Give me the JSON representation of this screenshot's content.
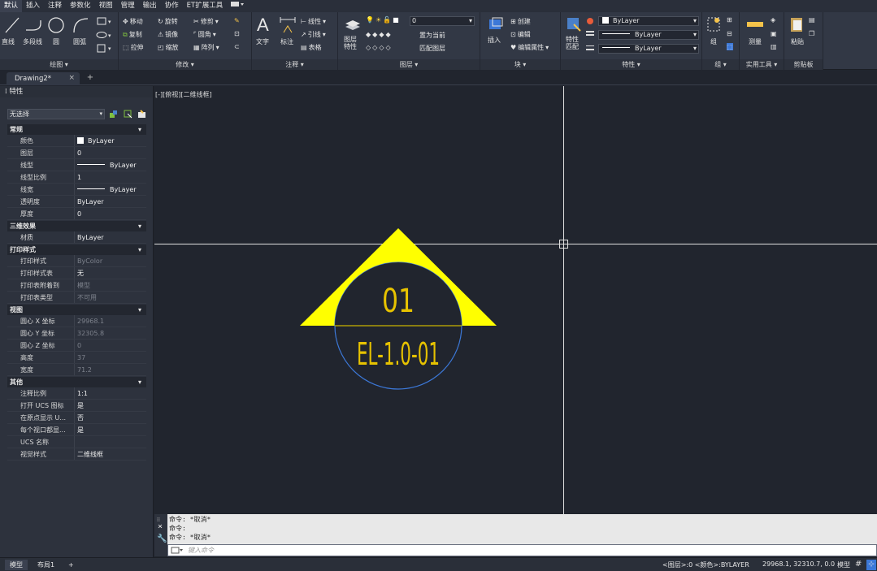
{
  "menu_tabs": [
    "默认",
    "插入",
    "注释",
    "参数化",
    "视图",
    "管理",
    "输出",
    "协作",
    "ET扩展工具"
  ],
  "ribbon": {
    "draw": {
      "line": "直线",
      "polyline": "多段线",
      "circle": "圆",
      "arc": "圆弧",
      "title": "绘图 ▾"
    },
    "modify": {
      "move": "移动",
      "rotate": "旋转",
      "trim": "修剪",
      "copy": "复制",
      "mirror": "镜像",
      "fillet": "圆角",
      "stretch": "拉伸",
      "scale": "缩放",
      "array": "阵列",
      "title": "修改 ▾"
    },
    "annotation": {
      "text": "文字",
      "dimension": "标注",
      "linear": "线性",
      "leader": "引线",
      "table": "表格",
      "title": "注释 ▾"
    },
    "layers": {
      "layer_props": "图层\n特性",
      "current_layer": "0",
      "set_current": "置为当前",
      "match_layer": "匹配图层",
      "title": "图层 ▾"
    },
    "block": {
      "insert": "插入",
      "create": "创建",
      "edit": "编辑",
      "edit_attr": "编辑属性",
      "title": "块 ▾"
    },
    "properties": {
      "match": "特性\n匹配",
      "color": "ByLayer",
      "linetype": "ByLayer",
      "lineweight": "ByLayer",
      "title": "特性 ▾"
    },
    "groups": {
      "group": "组",
      "title": "组 ▾"
    },
    "utilities": {
      "measure": "测量",
      "title": "实用工具 ▾"
    },
    "clipboard": {
      "paste": "粘贴",
      "title": "剪贴板"
    }
  },
  "doc_tab": {
    "name": "Drawing2*",
    "close": "×",
    "add": "+"
  },
  "properties_panel": {
    "title": "特性",
    "selection": "无选择",
    "sections": {
      "general": "常规",
      "3d": "三维效果",
      "plot": "打印样式",
      "view": "视图",
      "misc": "其他"
    },
    "general": [
      {
        "k": "颜色",
        "v": "ByLayer"
      },
      {
        "k": "图层",
        "v": "0"
      },
      {
        "k": "线型",
        "v": "ByLayer"
      },
      {
        "k": "线型比例",
        "v": "1"
      },
      {
        "k": "线宽",
        "v": "ByLayer"
      },
      {
        "k": "透明度",
        "v": "ByLayer"
      },
      {
        "k": "厚度",
        "v": "0"
      }
    ],
    "material": {
      "k": "材质",
      "v": "ByLayer"
    },
    "plot": [
      {
        "k": "打印样式",
        "v": "ByColor"
      },
      {
        "k": "打印样式表",
        "v": "无"
      },
      {
        "k": "打印表附着到",
        "v": "模型"
      },
      {
        "k": "打印表类型",
        "v": "不可用"
      }
    ],
    "view": [
      {
        "k": "圆心 X 坐标",
        "v": "29968.1"
      },
      {
        "k": "圆心 Y 坐标",
        "v": "32305.8"
      },
      {
        "k": "圆心 Z 坐标",
        "v": "0"
      },
      {
        "k": "高度",
        "v": "37"
      },
      {
        "k": "宽度",
        "v": "71.2"
      }
    ],
    "misc": [
      {
        "k": "注释比例",
        "v": "1:1"
      },
      {
        "k": "打开 UCS 图标",
        "v": "是"
      },
      {
        "k": "在原点显示 U...",
        "v": "否"
      },
      {
        "k": "每个视口都显...",
        "v": "是"
      },
      {
        "k": "UCS 名称",
        "v": ""
      },
      {
        "k": "视觉样式",
        "v": "二维线框"
      }
    ]
  },
  "viewport_label": "[-][俯视][二维线框]",
  "drawing": {
    "symbol_number": "01",
    "symbol_ref": "EL-1.0-01",
    "triangle_color": "#ffff00",
    "circle_color": "#3c78d8",
    "text_color": "#e6c200"
  },
  "command": {
    "history": [
      "命令: *取消*",
      "命令:",
      "命令: *取消*"
    ],
    "placeholder": "键入命令"
  },
  "status": {
    "model_tab": "模型",
    "layout_tab": "布局1",
    "add": "+",
    "layer_info": "<图层>:0 <颜色>:BYLAYER",
    "coords": "29968.1, 32310.7, 0.0",
    "model": "模型"
  }
}
